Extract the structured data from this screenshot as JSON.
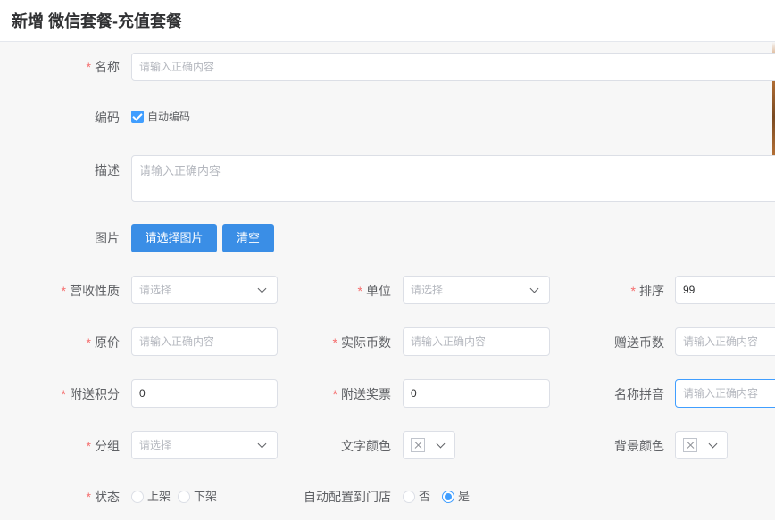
{
  "header": {
    "title": "新增 微信套餐-充值套餐"
  },
  "form": {
    "name": {
      "label": "名称",
      "placeholder": "请输入正确内容"
    },
    "code": {
      "label": "编码",
      "auto_label": "自动编码",
      "auto_checked": true
    },
    "description": {
      "label": "描述",
      "placeholder": "请输入正确内容"
    },
    "image": {
      "label": "图片",
      "select_button": "请选择图片",
      "clear_button": "清空"
    },
    "revenue_type": {
      "label": "营收性质",
      "placeholder": "请选择"
    },
    "unit": {
      "label": "单位",
      "placeholder": "请选择"
    },
    "sort": {
      "label": "排序",
      "value": "99"
    },
    "original_price": {
      "label": "原价",
      "placeholder": "请输入正确内容"
    },
    "actual_coins": {
      "label": "实际币数",
      "placeholder": "请输入正确内容"
    },
    "bonus_coins": {
      "label": "赠送币数",
      "placeholder": "请输入正确内容"
    },
    "bonus_points": {
      "label": "附送积分",
      "value": "0"
    },
    "bonus_tickets": {
      "label": "附送奖票",
      "value": "0"
    },
    "name_pinyin": {
      "label": "名称拼音",
      "placeholder": "请输入正确内容"
    },
    "group": {
      "label": "分组",
      "placeholder": "请选择"
    },
    "text_color": {
      "label": "文字颜色"
    },
    "bg_color": {
      "label": "背景颜色"
    },
    "status": {
      "label": "状态",
      "options": [
        "上架",
        "下架"
      ],
      "selected": null
    },
    "auto_store": {
      "label": "自动配置到门店",
      "options": [
        "否",
        "是"
      ],
      "selected": "是"
    }
  },
  "colors": {
    "primary": "#409eff",
    "button": "#3a8ee6",
    "required": "#f56c6c"
  }
}
